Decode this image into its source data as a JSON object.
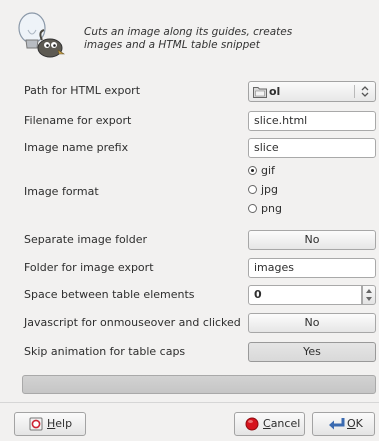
{
  "dialog": {
    "description_line1": "Cuts an image along its guides, creates",
    "description_line2": "images and a HTML table snippet"
  },
  "fields": {
    "path_label": "Path for HTML export",
    "path_value": "ol",
    "filename_label": "Filename for export",
    "filename_value": "slice.html",
    "prefix_label": "Image name prefix",
    "prefix_value": "slice",
    "format_label": "Image format",
    "format_options": [
      "gif",
      "jpg",
      "png"
    ],
    "format_selected": "gif",
    "separate_label": "Separate image folder",
    "separate_value": "No",
    "folder_label": "Folder for image export",
    "folder_value": "images",
    "space_label": "Space between table elements",
    "space_value": "0",
    "js_label": "Javascript for onmouseover and clicked",
    "js_value": "No",
    "skip_label": "Skip animation for table caps",
    "skip_value": "Yes"
  },
  "buttons": {
    "help_first": "H",
    "help_rest": "elp",
    "cancel_first": "C",
    "cancel_rest": "ancel",
    "ok_first": "O",
    "ok_rest": "K"
  },
  "progress": {
    "fraction": 0
  },
  "icons": {
    "logo": "gimp-wilber-lightbulb-icon",
    "folder": "folder-icon",
    "help": "help-icon",
    "cancel": "cancel-icon",
    "ok": "ok-icon"
  }
}
